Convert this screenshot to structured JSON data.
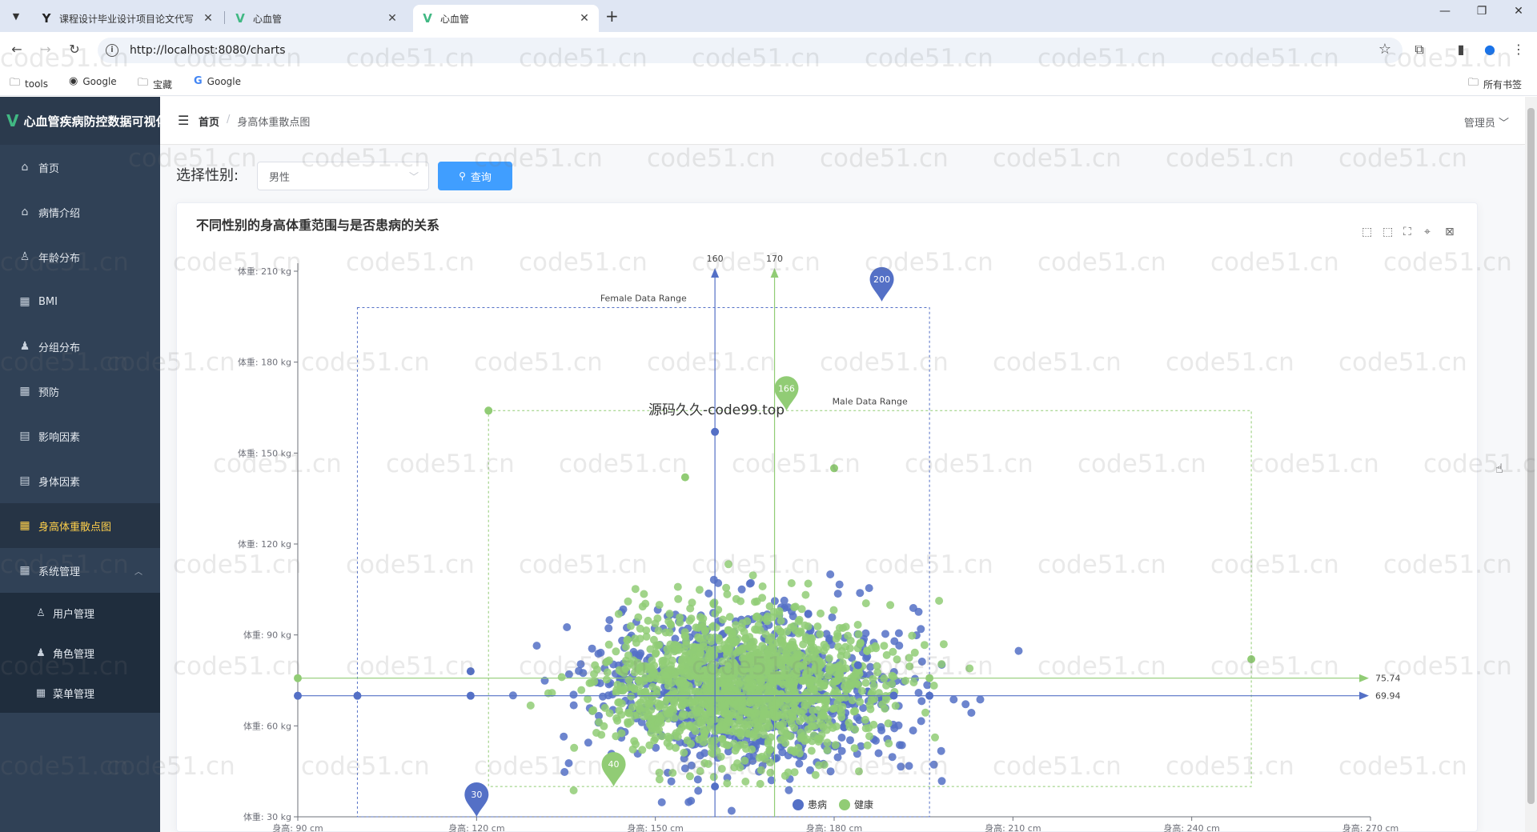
{
  "browser": {
    "tabs": [
      {
        "favicon": "Y",
        "title": "课程设计毕业设计项目论文代写",
        "active": false
      },
      {
        "favicon": "V",
        "title": "心血管",
        "active": false
      },
      {
        "favicon": "V",
        "title": "心血管",
        "active": true
      }
    ],
    "url": "http://localhost:8080/charts",
    "bookmarks": [
      "tools",
      "Google",
      "宝藏",
      "Google"
    ],
    "all_bookmarks": "所有书签"
  },
  "app": {
    "title": "心血管疾病防控数据可视化",
    "user": "管理员",
    "breadcrumb": {
      "home": "首页",
      "current": "身高体重散点图"
    }
  },
  "sidebar": {
    "items": [
      {
        "label": "首页",
        "icon": "home-icon"
      },
      {
        "label": "病情介绍",
        "icon": "home-icon"
      },
      {
        "label": "年龄分布",
        "icon": "user-icon"
      },
      {
        "label": "BMI",
        "icon": "grid-icon"
      },
      {
        "label": "分组分布",
        "icon": "person-icon"
      },
      {
        "label": "预防",
        "icon": "grid-icon"
      },
      {
        "label": "影响因素",
        "icon": "document-icon"
      },
      {
        "label": "身体因素",
        "icon": "document-icon"
      },
      {
        "label": "身高体重散点图",
        "icon": "grid-icon",
        "active": true
      },
      {
        "label": "系统管理",
        "icon": "grid-icon"
      }
    ],
    "subitems": [
      {
        "label": "用户管理",
        "icon": "user-icon"
      },
      {
        "label": "角色管理",
        "icon": "person-icon"
      },
      {
        "label": "菜单管理",
        "icon": "grid-icon"
      }
    ]
  },
  "filter": {
    "label": "选择性别:",
    "selected": "男性",
    "query_label": "查询"
  },
  "watermark": {
    "text": "code51.cn",
    "overlay": "源码久久-code99.top"
  },
  "chart_data": {
    "type": "scatter",
    "title": "不同性别的身高体重范围与是否患病的关系",
    "x_prefix": "身高: ",
    "x_suffix": " cm",
    "y_prefix": "体重: ",
    "y_suffix": " kg",
    "xlim": [
      90,
      270
    ],
    "ylim": [
      30,
      210
    ],
    "x_ticks": [
      90,
      120,
      150,
      180,
      210,
      240,
      270
    ],
    "y_ticks": [
      30,
      60,
      90,
      120,
      150,
      180,
      210
    ],
    "legend": [
      "患病",
      "健康"
    ],
    "legend_position": "bottom-center",
    "colors": {
      "sick": "#5470c6",
      "healthy": "#91cc75"
    },
    "mark_areas": [
      {
        "name": "Female Data Range",
        "x": [
          100,
          196
        ],
        "y": [
          30,
          198
        ],
        "color": "#5470c6"
      },
      {
        "name": "Male Data Range",
        "x": [
          122,
          250
        ],
        "y": [
          40,
          164
        ],
        "color": "#91cc75"
      }
    ],
    "avg_lines": [
      {
        "value": 69.94,
        "label": "69.94",
        "axis": "y",
        "color": "#5470c6"
      },
      {
        "value": 75.74,
        "label": "75.74",
        "axis": "y",
        "color": "#91cc75"
      },
      {
        "value": 160,
        "label": "160",
        "axis": "x",
        "color": "#5470c6"
      },
      {
        "value": 170,
        "label": "170",
        "axis": "x",
        "color": "#91cc75"
      }
    ],
    "mark_points": [
      {
        "label": "200",
        "x": 188,
        "y": 200,
        "color": "#5470c6"
      },
      {
        "label": "30",
        "x": 120,
        "y": 30,
        "color": "#5470c6"
      },
      {
        "label": "166",
        "x": 172,
        "y": 164,
        "color": "#91cc75"
      },
      {
        "label": "40",
        "x": 143,
        "y": 40,
        "color": "#91cc75"
      }
    ],
    "outliers": {
      "sick": [
        [
          160,
          157
        ],
        [
          119,
          78
        ],
        [
          119,
          69.94
        ],
        [
          100,
          69.94
        ],
        [
          90,
          69.94
        ],
        [
          196,
          69.94
        ],
        [
          184,
          80
        ],
        [
          190,
          70
        ],
        [
          160,
          40
        ]
      ],
      "healthy": [
        [
          122,
          164
        ],
        [
          250,
          82
        ],
        [
          196,
          75.74
        ],
        [
          90,
          75.74
        ],
        [
          155,
          142
        ],
        [
          180,
          145
        ]
      ]
    },
    "clusters": {
      "sick": {
        "center": [
          166,
          72
        ],
        "spread": [
          13,
          13
        ],
        "count": 900
      },
      "healthy": {
        "center": [
          165,
          74
        ],
        "spread": [
          11,
          12
        ],
        "count": 1400
      }
    }
  }
}
